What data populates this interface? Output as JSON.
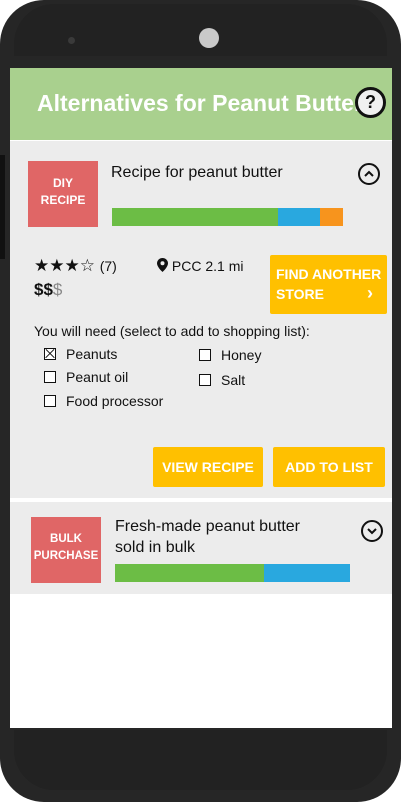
{
  "header": {
    "title": "Alternatives for Peanut Butter",
    "help_label": "?"
  },
  "card1": {
    "tag_line1": "DIY",
    "tag_line2": "RECIPE",
    "title": "Recipe for peanut butter",
    "bar_colors": [
      "#6cbd45",
      "#29a8df",
      "#f7941d"
    ],
    "stars": "★★★☆",
    "review_count": "(7)",
    "location": "PCC 2.1 mi",
    "price_active": "$$",
    "price_inactive": "$",
    "find_line1": "FIND ANOTHER",
    "find_line2": "STORE",
    "find_arrow": "›",
    "need_label": "You will need (select to add to shopping list):",
    "items": [
      {
        "label": "Peanuts",
        "checked": true
      },
      {
        "label": "Honey",
        "checked": false
      },
      {
        "label": "Peanut oil",
        "checked": false
      },
      {
        "label": "Salt",
        "checked": false
      },
      {
        "label": "Food processor",
        "checked": false
      }
    ],
    "view_recipe": "VIEW RECIPE",
    "add_to_list": "ADD TO LIST"
  },
  "card2": {
    "tag_line1": "BULK",
    "tag_line2": "PURCHASE",
    "title_line1": "Fresh-made peanut butter",
    "title_line2": "sold in bulk",
    "bar_colors": [
      "#6cbd45",
      "#29a8df"
    ]
  }
}
